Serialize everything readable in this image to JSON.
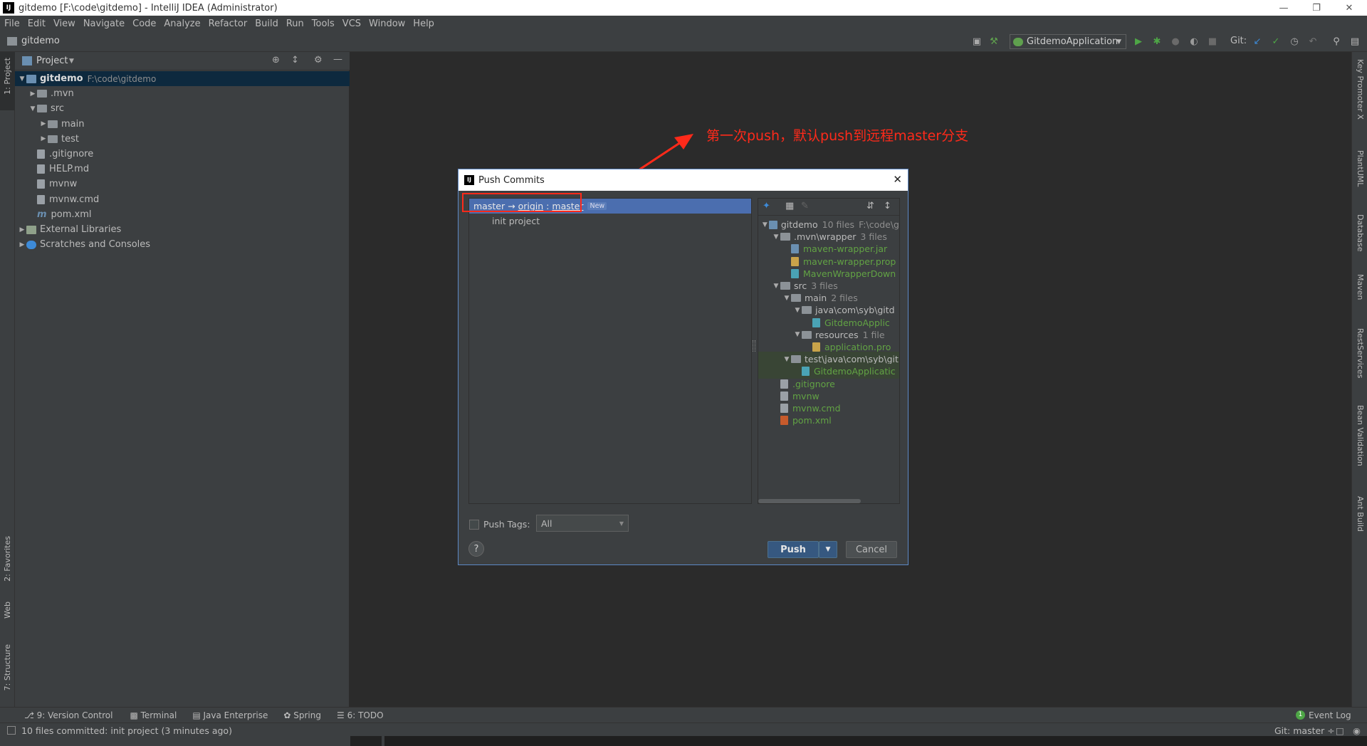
{
  "window": {
    "title": "gitdemo [F:\\code\\gitdemo] - IntelliJ IDEA (Administrator)",
    "app_icon": "IJ"
  },
  "menu": [
    "File",
    "Edit",
    "View",
    "Navigate",
    "Code",
    "Analyze",
    "Refactor",
    "Build",
    "Run",
    "Tools",
    "VCS",
    "Window",
    "Help"
  ],
  "navbar": {
    "project": "gitdemo",
    "run_config": "GitdemoApplication",
    "git_label": "Git:"
  },
  "left_stripe": {
    "project_tab": "1: Project",
    "favorites_tab": "2: Favorites",
    "web_tab": "Web",
    "structure_tab": "7: Structure"
  },
  "right_stripe": [
    "Key Promoter X",
    "PlantUML",
    "Database",
    "Maven",
    "RestServices",
    "Bean Validation",
    "Ant Build"
  ],
  "project_panel": {
    "title": "Project",
    "tree": [
      {
        "label": "gitdemo",
        "extra": "F:\\code\\gitdemo",
        "depth": 0,
        "kind": "module",
        "expanded": true
      },
      {
        "label": ".mvn",
        "depth": 1,
        "kind": "folder",
        "expanded": false
      },
      {
        "label": "src",
        "depth": 1,
        "kind": "folder",
        "expanded": true
      },
      {
        "label": "main",
        "depth": 2,
        "kind": "folder",
        "expanded": false
      },
      {
        "label": "test",
        "depth": 2,
        "kind": "folder",
        "expanded": false
      },
      {
        "label": ".gitignore",
        "depth": 1,
        "kind": "file"
      },
      {
        "label": "HELP.md",
        "depth": 1,
        "kind": "file"
      },
      {
        "label": "mvnw",
        "depth": 1,
        "kind": "file"
      },
      {
        "label": "mvnw.cmd",
        "depth": 1,
        "kind": "file"
      },
      {
        "label": "pom.xml",
        "depth": 1,
        "kind": "maven"
      },
      {
        "label": "External Libraries",
        "depth": 0,
        "kind": "lib",
        "expanded": false
      },
      {
        "label": "Scratches and Consoles",
        "depth": 0,
        "kind": "scratch",
        "expanded": false
      }
    ]
  },
  "dialog": {
    "title": "Push Commits",
    "branch": {
      "local": "master",
      "arrow": "→",
      "remote": "origin",
      "sep": ":",
      "target": "master",
      "badge": "New"
    },
    "commit": "init project",
    "files": [
      {
        "label": "gitdemo",
        "count": "10 files",
        "extra": "F:\\code\\g",
        "depth": 0,
        "kind": "module",
        "arrow": "▼"
      },
      {
        "label": ".mvn\\wrapper",
        "count": "3 files",
        "depth": 1,
        "kind": "folder",
        "arrow": "▼"
      },
      {
        "label": "maven-wrapper.jar",
        "depth": 2,
        "kind": "jar",
        "green": true
      },
      {
        "label": "maven-wrapper.prop",
        "depth": 2,
        "kind": "props",
        "green": true
      },
      {
        "label": "MavenWrapperDown",
        "depth": 2,
        "kind": "java",
        "green": true
      },
      {
        "label": "src",
        "count": "3 files",
        "depth": 1,
        "kind": "folder",
        "arrow": "▼"
      },
      {
        "label": "main",
        "count": "2 files",
        "depth": 2,
        "kind": "folder",
        "arrow": "▼"
      },
      {
        "label": "java\\com\\syb\\gitd",
        "depth": 3,
        "kind": "folder",
        "arrow": "▼"
      },
      {
        "label": "GitdemoApplic",
        "depth": 4,
        "kind": "java",
        "green": true
      },
      {
        "label": "resources",
        "count": "1 file",
        "depth": 3,
        "kind": "folder",
        "arrow": "▼"
      },
      {
        "label": "application.pro",
        "depth": 4,
        "kind": "props",
        "green": true
      },
      {
        "label": "test\\java\\com\\syb\\git",
        "depth": 2,
        "kind": "folder",
        "arrow": "▼",
        "highlight": true
      },
      {
        "label": "GitdemoApplicatic",
        "depth": 3,
        "kind": "java",
        "green": true,
        "highlight": true
      },
      {
        "label": ".gitignore",
        "depth": 1,
        "kind": "file",
        "green": true
      },
      {
        "label": "mvnw",
        "depth": 1,
        "kind": "file",
        "green": true
      },
      {
        "label": "mvnw.cmd",
        "depth": 1,
        "kind": "file",
        "green": true
      },
      {
        "label": "pom.xml",
        "depth": 1,
        "kind": "maven",
        "green": true
      }
    ],
    "push_tags_label": "Push Tags:",
    "push_tags_value": "All",
    "help": "?",
    "push_button": "Push",
    "cancel_button": "Cancel"
  },
  "annotation": "第一次push，默认push到远程master分支",
  "bottom_tabs": [
    "9: Version Control",
    "Terminal",
    "Java Enterprise",
    "Spring",
    "6: TODO"
  ],
  "event_log": "Event Log",
  "event_count": "1",
  "status": {
    "message": "10 files committed: init project (3 minutes ago)",
    "git": "Git: master ÷"
  },
  "colors": {
    "accent": "#4b6eaf",
    "annotation": "#ff2a1a",
    "added_file": "#62a344"
  }
}
